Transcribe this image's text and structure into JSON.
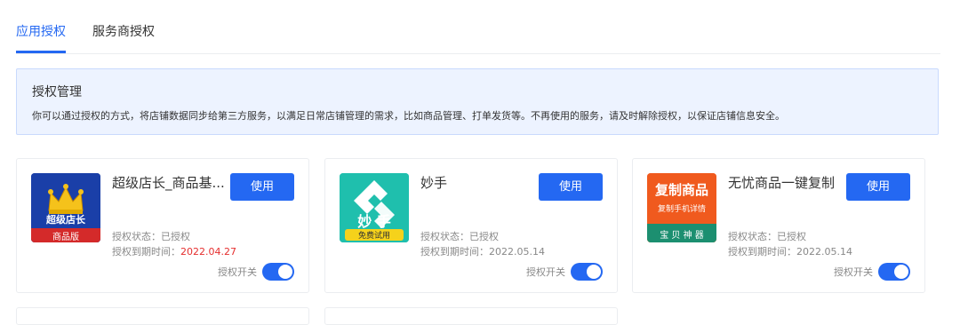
{
  "tabs": [
    {
      "label": "应用授权",
      "active": true
    },
    {
      "label": "服务商授权",
      "active": false
    }
  ],
  "notice": {
    "title": "授权管理",
    "text": "你可以通过授权的方式，将店铺数据同步给第三方服务，以满足日常店铺管理的需求，比如商品管理、打单发货等。不再使用的服务，请及时解除授权，以保证店铺信息安全。"
  },
  "colors": {
    "accent": "#2468f2",
    "expired_warning": "#e52e2e",
    "notice_bg": "#edf3ff"
  },
  "cards": [
    {
      "name": "超级店长_商品基...",
      "use_label": "使用",
      "status": "授权状态：已授权",
      "expire_label": "授权到期时间：",
      "expire_date": "2022.04.27",
      "expire_highlight": true,
      "switch_label": "授权开关",
      "switch_on": true,
      "logo": {
        "icon": "crown-icon",
        "line1": "超级店长",
        "line2": "商品版"
      }
    },
    {
      "name": "妙手",
      "use_label": "使用",
      "status": "授权状态：已授权",
      "expire_label": "授权到期时间：",
      "expire_date": "2022.05.14",
      "expire_highlight": false,
      "switch_label": "授权开关",
      "switch_on": true,
      "logo": {
        "icon": "miaoshou-logo-icon",
        "line1": "妙 手",
        "line2": "免费试用"
      }
    },
    {
      "name": "无忧商品一键复制",
      "use_label": "使用",
      "status": "授权状态：已授权",
      "expire_label": "授权到期时间：",
      "expire_date": "2022.05.14",
      "expire_highlight": false,
      "switch_label": "授权开关",
      "switch_on": true,
      "logo": {
        "icon": "copy-goods-icon",
        "line1": "复制商品",
        "line2": "复制手机详情",
        "line3": "宝 贝 神 器"
      }
    }
  ]
}
